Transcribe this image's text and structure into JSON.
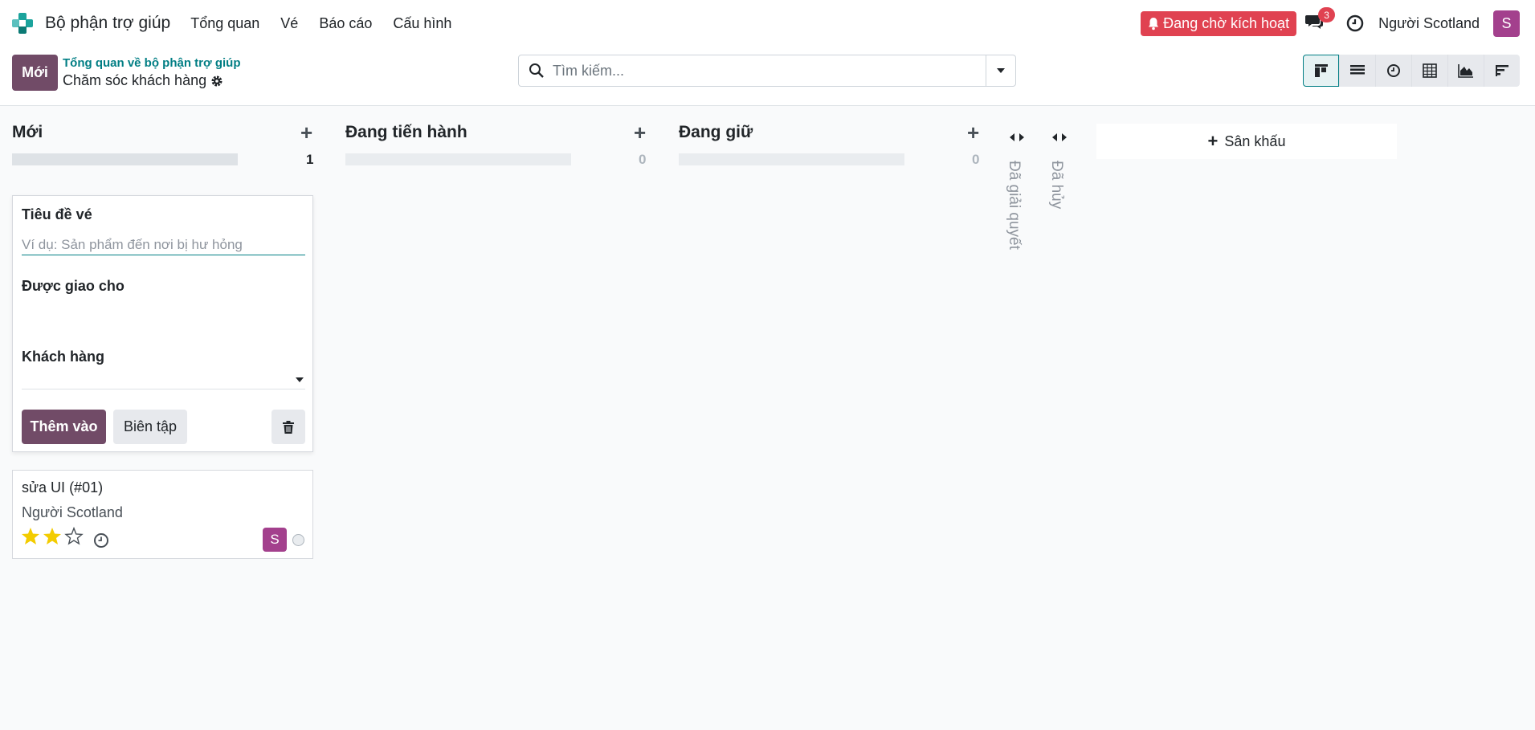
{
  "navbar": {
    "app_name": "Bộ phận trợ giúp",
    "menu": [
      "Tổng quan",
      "Vé",
      "Báo cáo",
      "Cấu hình"
    ],
    "activate_label": "Đang chờ kích hoạt",
    "chat_count": "3",
    "user_name": "Người Scotland",
    "avatar_letter": "S",
    "colors": {
      "brand": "#714b67",
      "alert": "#e04251",
      "avatar": "#a3408d",
      "link": "#017e84"
    }
  },
  "control": {
    "new_label": "Mới",
    "breadcrumb": "Tổng quan về bộ phận trợ giúp",
    "title": "Chăm sóc khách hàng",
    "search_placeholder": "Tìm kiếm...",
    "views": [
      "kanban-icon",
      "list-icon",
      "activity-icon",
      "pivot-icon",
      "graph-icon",
      "gantt-icon"
    ]
  },
  "kanban": {
    "columns": [
      {
        "name": "Mới",
        "count": "1"
      },
      {
        "name": "Đang tiến hành",
        "count": "0"
      },
      {
        "name": "Đang giữ",
        "count": "0"
      }
    ],
    "folded": [
      "Đã giải quyết",
      "Đã hủy"
    ],
    "add_stage_label": "Sân khấu"
  },
  "quick_create": {
    "title_label": "Tiêu đề vé",
    "title_placeholder": "Ví dụ: Sản phẩm đến nơi bị hư hỏng",
    "assigned_label": "Được giao cho",
    "customer_label": "Khách hàng",
    "add_label": "Thêm vào",
    "edit_label": "Biên tập"
  },
  "ticket": {
    "title": "sửa UI (#01)",
    "customer": "Người Scotland",
    "priority": 2,
    "priority_max": 3,
    "avatar_letter": "S"
  }
}
